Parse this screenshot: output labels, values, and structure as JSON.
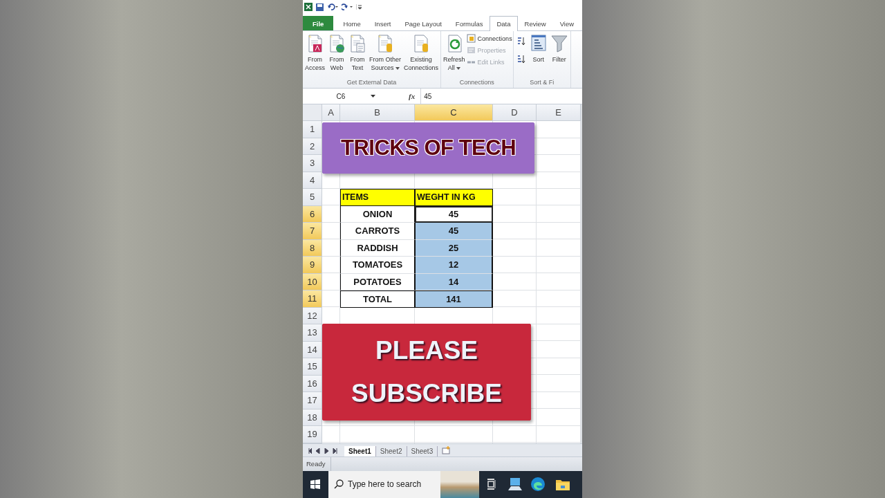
{
  "ribbon_tabs": [
    {
      "label": "File",
      "kind": "file",
      "selected": false
    },
    {
      "label": "Home",
      "kind": "tab",
      "selected": false
    },
    {
      "label": "Insert",
      "kind": "tab",
      "selected": false
    },
    {
      "label": "Page Layout",
      "kind": "tab",
      "selected": false
    },
    {
      "label": "Formulas",
      "kind": "tab",
      "selected": false
    },
    {
      "label": "Data",
      "kind": "tab",
      "selected": true
    },
    {
      "label": "Review",
      "kind": "tab",
      "selected": false
    },
    {
      "label": "View",
      "kind": "tab",
      "selected": false
    }
  ],
  "ribbon_groups": [
    {
      "label": "Get External Data",
      "kind": "external",
      "buttons": [
        {
          "kind": "large",
          "lines": [
            "From",
            "Access"
          ],
          "has_menu": false,
          "disabled": false
        },
        {
          "kind": "large",
          "lines": [
            "From",
            "Web"
          ],
          "has_menu": false,
          "disabled": false
        },
        {
          "kind": "large",
          "lines": [
            "From",
            "Text"
          ],
          "has_menu": false,
          "disabled": false
        },
        {
          "kind": "large",
          "lines": [
            "From Other",
            "Sources"
          ],
          "has_menu": true,
          "disabled": false
        },
        {
          "kind": "large",
          "lines": [
            "Existing",
            "Connections"
          ],
          "has_menu": false,
          "disabled": false
        }
      ]
    },
    {
      "label": "Connections",
      "kind": "connections",
      "buttons": [
        {
          "kind": "large",
          "lines": [
            "Refresh",
            "All"
          ],
          "has_menu": true,
          "disabled": false
        },
        {
          "kind": "small",
          "lines": [
            "Connections"
          ],
          "has_menu": false,
          "disabled": false
        },
        {
          "kind": "small",
          "lines": [
            "Properties"
          ],
          "has_menu": false,
          "disabled": true
        },
        {
          "kind": "small",
          "lines": [
            "Edit Links"
          ],
          "has_menu": false,
          "disabled": true
        }
      ]
    },
    {
      "label": "Sort & Fi",
      "kind": "sort",
      "buttons": [
        {
          "kind": "large",
          "lines": [
            "Sort"
          ],
          "has_menu": false,
          "disabled": false
        },
        {
          "kind": "large",
          "lines": [
            "Filter"
          ],
          "has_menu": false,
          "disabled": false
        }
      ]
    }
  ],
  "formula_bar": {
    "name_box": "C6",
    "function_label": "fx",
    "value": "45"
  },
  "columns": [
    {
      "label": "A",
      "selected": false
    },
    {
      "label": "B",
      "selected": false
    },
    {
      "label": "C",
      "selected": true
    },
    {
      "label": "D",
      "selected": false
    },
    {
      "label": "E",
      "selected": false
    }
  ],
  "rows": [
    {
      "label": "1",
      "selected": false
    },
    {
      "label": "2",
      "selected": false
    },
    {
      "label": "3",
      "selected": false
    },
    {
      "label": "4",
      "selected": false
    },
    {
      "label": "5",
      "selected": false
    },
    {
      "label": "6",
      "selected": true
    },
    {
      "label": "7",
      "selected": true
    },
    {
      "label": "8",
      "selected": true
    },
    {
      "label": "9",
      "selected": true
    },
    {
      "label": "10",
      "selected": true
    },
    {
      "label": "11",
      "selected": true
    },
    {
      "label": "12",
      "selected": false
    },
    {
      "label": "13",
      "selected": false
    },
    {
      "label": "14",
      "selected": false
    },
    {
      "label": "15",
      "selected": false
    },
    {
      "label": "16",
      "selected": false
    },
    {
      "label": "17",
      "selected": false
    },
    {
      "label": "18",
      "selected": false
    },
    {
      "label": "19",
      "selected": false
    }
  ],
  "table": {
    "header": [
      "ITEMS",
      "WEGHT IN KG"
    ],
    "rows": [
      {
        "item": "ONION",
        "weight": "45",
        "selected": true,
        "active": true
      },
      {
        "item": "CARROTS",
        "weight": "45",
        "selected": true,
        "active": false
      },
      {
        "item": "RADDISH",
        "weight": "25",
        "selected": true,
        "active": false
      },
      {
        "item": "TOMATOES",
        "weight": "12",
        "selected": true,
        "active": false
      },
      {
        "item": "POTATOES",
        "weight": "14",
        "selected": true,
        "active": false
      },
      {
        "item": "TOTAL",
        "weight": "141",
        "selected": true,
        "active": false
      }
    ]
  },
  "shapes": [
    {
      "kind": "banner",
      "text": "TRICKS OF TECH",
      "color": "#9a6cc6"
    },
    {
      "kind": "button",
      "text": "PLEASE SUBSCRIBE",
      "color": "#c8283c"
    }
  ],
  "sheet_tabs": [
    {
      "label": "Sheet1",
      "selected": true
    },
    {
      "label": "Sheet2",
      "selected": false
    },
    {
      "label": "Sheet3",
      "selected": false
    }
  ],
  "status_bar": {
    "text": "Ready"
  },
  "taskbar": {
    "search_placeholder": "Type here to search"
  }
}
